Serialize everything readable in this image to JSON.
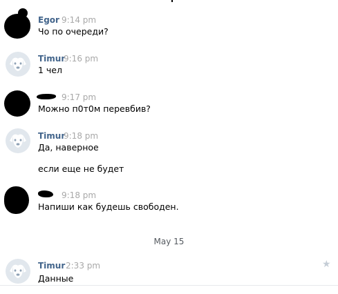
{
  "messages": [
    {
      "author": "Egor",
      "time": "9:14 pm",
      "lines": [
        "Чо по очереди?"
      ]
    },
    {
      "author": "Timur",
      "time": "9:16 pm",
      "lines": [
        "1 чел"
      ]
    },
    {
      "author": "",
      "time": "9:17 pm",
      "lines": [
        "Можно п0т0м перевбив?"
      ]
    },
    {
      "author": "Timur",
      "time": "9:18 pm",
      "lines": [
        "Да, наверное",
        "если еще не будет"
      ]
    },
    {
      "author": "",
      "time": "9:18 pm",
      "lines": [
        "Напиши как будешь свободен."
      ]
    },
    {
      "author": "Timur",
      "time": "2:33 pm",
      "lines": [
        "Данные"
      ]
    }
  ],
  "date_separator": "May 15",
  "icons": {
    "default_avatar": "dog-avatar-icon",
    "favorite": "star-icon"
  },
  "colors": {
    "author_name": "#42648b",
    "timestamp": "#a8a8a8",
    "default_avatar_bg": "#e1e7ed",
    "star": "#c5cdd6"
  }
}
